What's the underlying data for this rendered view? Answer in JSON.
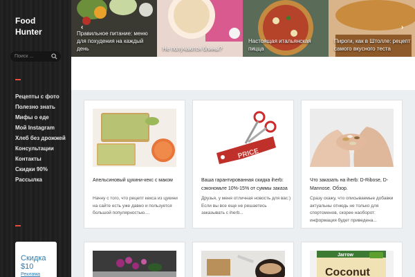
{
  "site": {
    "brand": "Food Hunter"
  },
  "search": {
    "placeholder": "Поиск ..."
  },
  "nav": {
    "items": [
      {
        "label": "Рецепты с фото"
      },
      {
        "label": "Полезно знать"
      },
      {
        "label": "Мифы о еде"
      },
      {
        "label": "Мой Instagram"
      },
      {
        "label": "Хлеб без дрожжей"
      },
      {
        "label": "Консультации"
      },
      {
        "label": "Контакты"
      },
      {
        "label": "Скидки 90%"
      },
      {
        "label": "Рассылка"
      }
    ]
  },
  "promo": {
    "title": "Скидка $10",
    "link": "Реклама"
  },
  "slider": {
    "prev": "‹",
    "next": "›",
    "slides": [
      {
        "caption": "Правильное питание: меню для похудения на каждый день"
      },
      {
        "caption": "Не получаются блины?"
      },
      {
        "caption": "Настоящая итальянская пицца"
      },
      {
        "caption": "Пироги, как в Штолле: рецепт самого вкусного теста"
      }
    ]
  },
  "posts": [
    {
      "title": "Апельсиновый цукини-кекс с маком",
      "excerpt": "Начну с того, что рецепт кекса из цукини на сайте есть уже давно и пользуется большой популярностью....",
      "image": "citrus-cake-photo"
    },
    {
      "title": "Ваша гарантированная скидка iherb: сэкономьте 10%-15% от суммы заказа",
      "excerpt": "Друзья, у меня отличная новость для вас:) Если вы все еще не решаетесь заказывать с iherb...",
      "image": "price-tag-scissors-photo"
    },
    {
      "title": "Что заказать на iherb: D-Ribose, D-Mannose. Обзор.",
      "excerpt": "Сразу скажу, что описываемые добавки актуальны отнюдь не только для спортсменов, скорее наоборот: информация будет приведена...",
      "image": "pills-in-hands-photo"
    },
    {
      "title": "",
      "excerpt": "",
      "image": "orchid-table-photo"
    },
    {
      "title": "",
      "excerpt": "",
      "image": "coffee-dessert-photo"
    },
    {
      "title": "",
      "excerpt": "",
      "image": "coconut-product-photo"
    }
  ],
  "images": {
    "tag_text": "PRICE",
    "product_brand": "Jarrow",
    "product_name": "Coconut"
  },
  "colors": {
    "accent": "#e74c3c",
    "link": "#2a7ab0",
    "sidebar_bg": "#1f1f1f",
    "page_bg": "#eceff1"
  }
}
